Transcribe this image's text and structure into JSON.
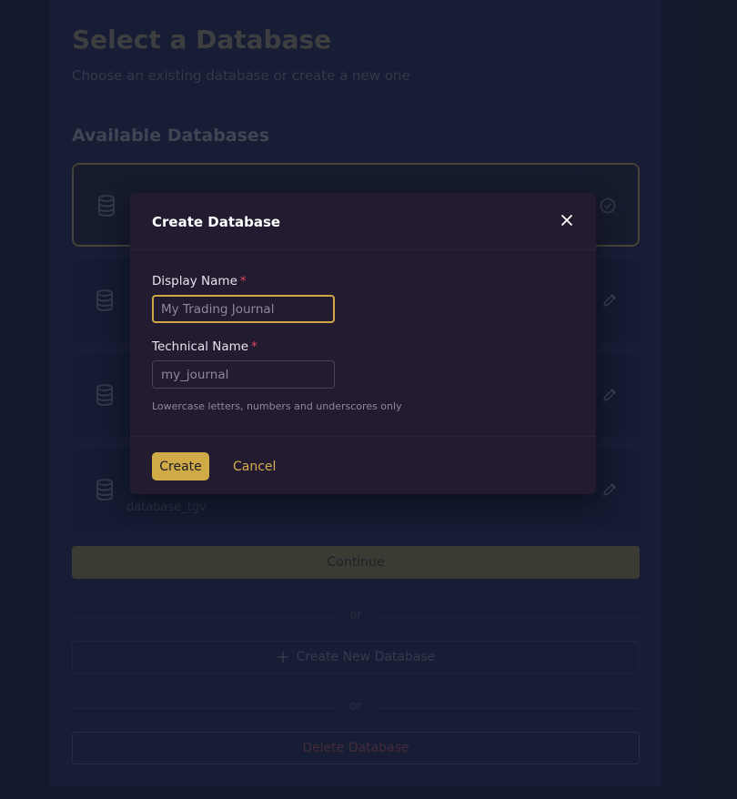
{
  "page": {
    "title": "Select a Database",
    "subtitle": "Choose an existing database or create a new one",
    "section_title": "Available Databases"
  },
  "databases": [
    {
      "name": "",
      "technical_name": "",
      "selected": true
    },
    {
      "name": "",
      "technical_name": ""
    },
    {
      "name": "",
      "technical_name": ""
    },
    {
      "name": "",
      "technical_name": "database_tgv"
    }
  ],
  "actions": {
    "continue_label": "Continue",
    "or_label": "or",
    "create_new_label": "Create New Database",
    "delete_label": "Delete Database"
  },
  "modal": {
    "title": "Create Database",
    "display_name_label": "Display Name",
    "display_name_placeholder": "My Trading Journal",
    "technical_name_label": "Technical Name",
    "technical_name_placeholder": "my_journal",
    "required_mark": "*",
    "help_text": "Lowercase letters, numbers and underscores only",
    "create_label": "Create",
    "cancel_label": "Cancel"
  },
  "colors": {
    "accent": "#d0aa47",
    "modal_bg": "#231c31",
    "page_bg": "#1b2238",
    "required": "#e0425e"
  }
}
